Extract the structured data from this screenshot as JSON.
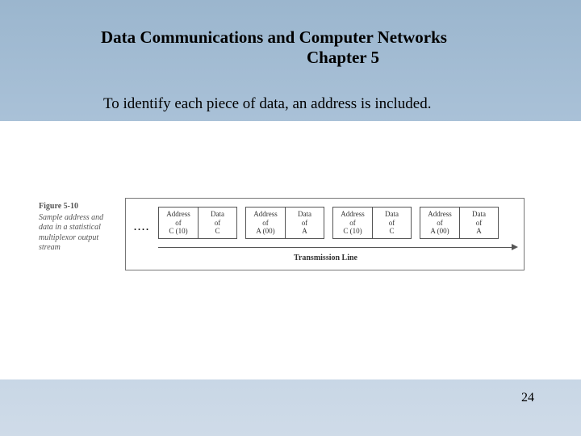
{
  "header": {
    "title_line1": "Data Communications and Computer Networks",
    "title_line2": "Chapter 5"
  },
  "body": {
    "sentence": "To identify each piece of data, an address is included."
  },
  "figure": {
    "number": "Figure 5-10",
    "caption": "Sample address and data in a statistical multiplexor output stream",
    "ellipsis": "....",
    "transmission_label": "Transmission Line",
    "pairs": [
      {
        "addr_line1": "Address",
        "addr_line2": "of",
        "addr_line3": "C (10)",
        "data_line1": "Data",
        "data_line2": "of",
        "data_line3": "C"
      },
      {
        "addr_line1": "Address",
        "addr_line2": "of",
        "addr_line3": "A (00)",
        "data_line1": "Data",
        "data_line2": "of",
        "data_line3": "A"
      },
      {
        "addr_line1": "Address",
        "addr_line2": "of",
        "addr_line3": "C (10)",
        "data_line1": "Data",
        "data_line2": "of",
        "data_line3": "C"
      },
      {
        "addr_line1": "Address",
        "addr_line2": "of",
        "addr_line3": "A (00)",
        "data_line1": "Data",
        "data_line2": "of",
        "data_line3": "A"
      }
    ]
  },
  "page_number": "24"
}
